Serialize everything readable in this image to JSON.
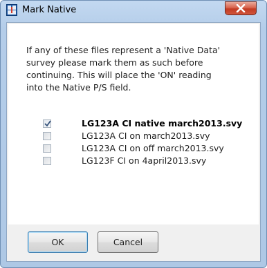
{
  "window": {
    "title": "Mark Native",
    "close_glyph": "x"
  },
  "message": "If any of these files represent a 'Native Data'\nsurvey please mark them as such before\ncontinuing. This will place the 'ON' reading\ninto the Native P/S field.",
  "files": [
    {
      "label": "LG123A CI native march2013.svy",
      "checked": true,
      "bold": true
    },
    {
      "label": "LG123A CI on march2013.svy",
      "checked": false,
      "bold": false
    },
    {
      "label": "LG123A CI on off march2013.svy",
      "checked": false,
      "bold": false
    },
    {
      "label": "LG123F CI on 4april2013.svy",
      "checked": false,
      "bold": false
    }
  ],
  "buttons": {
    "ok_label": "OK",
    "cancel_label": "Cancel"
  },
  "colors": {
    "titlebar": "#b4cde9",
    "close_red": "#c23b23",
    "default_button_border": "#3c7fb1"
  },
  "icons": {
    "app": "app-icon",
    "close": "close-icon",
    "check": "checkmark-icon"
  }
}
